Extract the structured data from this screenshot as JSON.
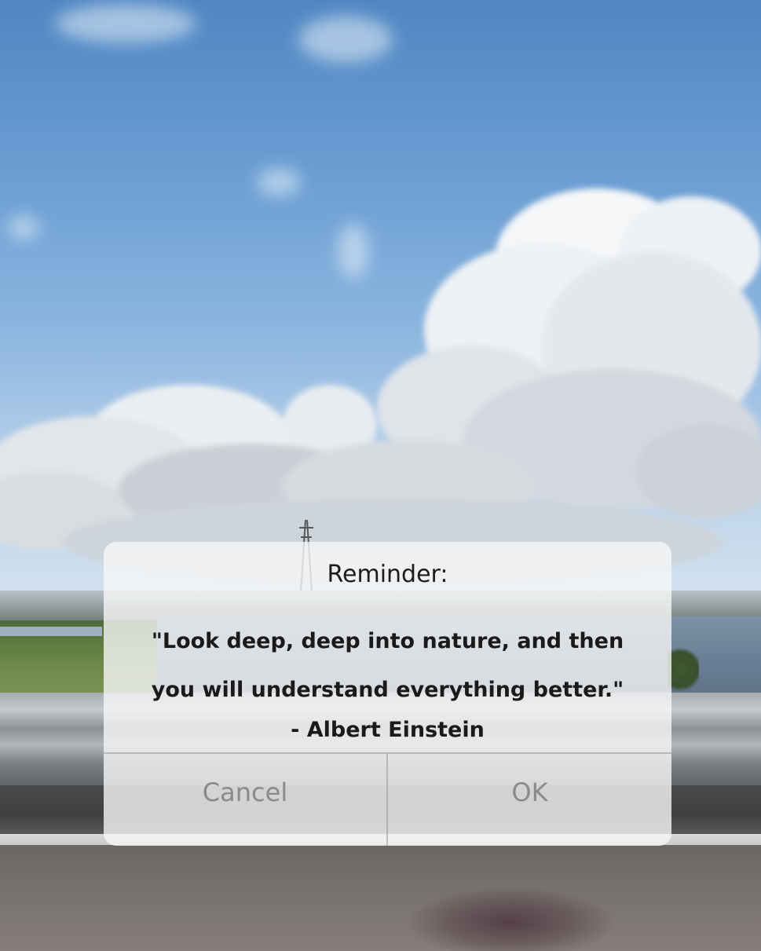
{
  "dialog": {
    "title": "Reminder:",
    "message_lines": [
      "\"Look deep, deep into nature, and then",
      "you will understand everything better.\""
    ],
    "author": "- Albert Einstein",
    "cancel_label": "Cancel",
    "ok_label": "OK"
  },
  "colors": {
    "sky": "#6c9fd3",
    "dialog_background": "#f6f6f6",
    "button_text": "#8a8a8a",
    "text": "#1a1a1a"
  }
}
